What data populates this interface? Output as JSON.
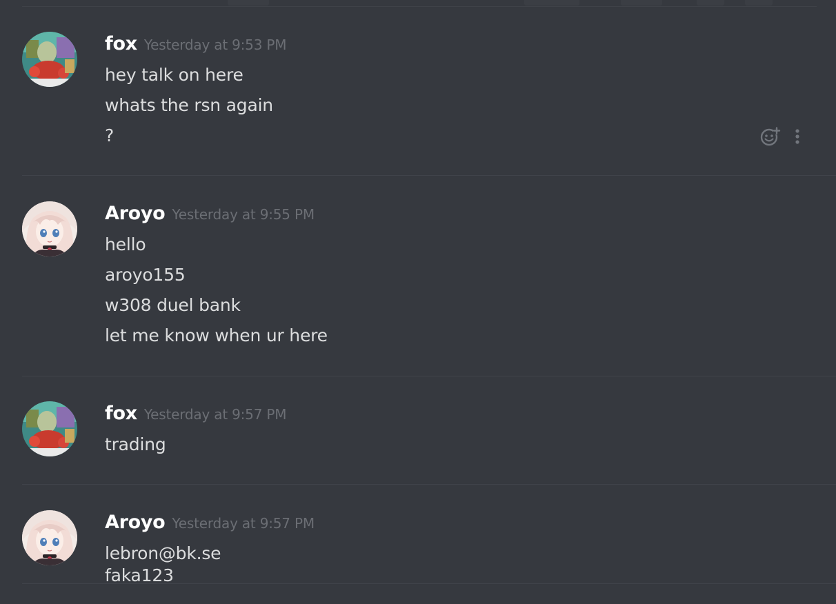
{
  "messages": [
    {
      "author": "fox",
      "timestamp": "Yesterday at 9:53 PM",
      "avatar": "fox-avatar",
      "lines": [
        "hey talk on here",
        "whats the rsn again",
        "?"
      ]
    },
    {
      "author": "Aroyo",
      "timestamp": "Yesterday at 9:55 PM",
      "avatar": "aroyo-avatar",
      "lines": [
        "hello",
        "aroyo155",
        "w308 duel bank",
        "let me know when ur here"
      ]
    },
    {
      "author": "fox",
      "timestamp": "Yesterday at 9:57 PM",
      "avatar": "fox-avatar",
      "lines": [
        "trading"
      ]
    },
    {
      "author": "Aroyo",
      "timestamp": "Yesterday at 9:57 PM",
      "avatar": "aroyo-avatar",
      "lines": [
        "lebron@bk.se",
        "faka123"
      ]
    }
  ],
  "hover_actions": {
    "add_reaction_icon": "emoji-add-icon",
    "more_icon": "more-vertical-icon"
  },
  "colors": {
    "background": "#36393f",
    "username": "#ffffff",
    "timestamp": "#6b6e74",
    "message_text": "#dcddde",
    "divider": "#40434a",
    "icon": "#72767d"
  }
}
